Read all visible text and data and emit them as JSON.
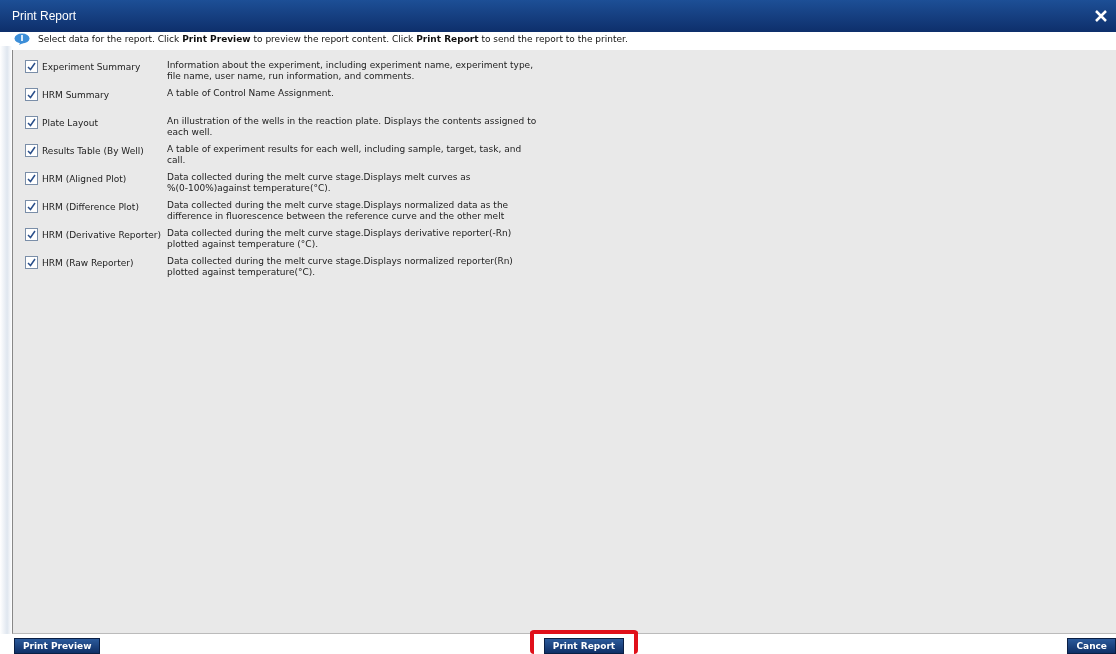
{
  "window": {
    "title": "Print Report"
  },
  "info": "Select data for the report. Click **Print Preview** to preview the report content. Click **Print Report** to send the report to the printer.",
  "sections": [
    {
      "label": "Experiment Summary",
      "checked": true,
      "description": "Information about the experiment, including experiment name, experiment type,\nfile name, user name, run information, and comments."
    },
    {
      "label": "HRM Summary",
      "checked": true,
      "description": "A table of Control Name Assignment."
    },
    {
      "label": "Plate Layout",
      "checked": true,
      "description": "An illustration of the wells in the reaction plate. Displays the contents assigned to\neach well."
    },
    {
      "label": "Results Table (By Well)",
      "checked": true,
      "description": "A table of experiment results for each well, including sample, target, task, and\ncall."
    },
    {
      "label": "HRM (Aligned Plot)",
      "checked": true,
      "description": "Data collected during the melt curve stage.Displays melt curves as\n%(0-100%)against temperature(°C)."
    },
    {
      "label": "HRM (Difference Plot)",
      "checked": true,
      "description": "Data collected during the melt curve stage.Displays normalized data as the\ndifference in fluorescence between the reference curve and the other melt"
    },
    {
      "label": "HRM (Derivative Reporter)",
      "checked": true,
      "description": "Data collected during the melt curve stage.Displays derivative reporter(-Rn)\nplotted against temperature (°C)."
    },
    {
      "label": "HRM (Raw Reporter)",
      "checked": true,
      "description": "Data collected during the melt curve stage.Displays normalized reporter(Rn)\nplotted against temperature(°C)."
    }
  ],
  "buttons": [
    {
      "label": "Print Preview",
      "highlighted": false
    },
    {
      "label": "Print Report",
      "highlighted": true
    },
    {
      "label": "Cance",
      "highlighted": false
    }
  ]
}
